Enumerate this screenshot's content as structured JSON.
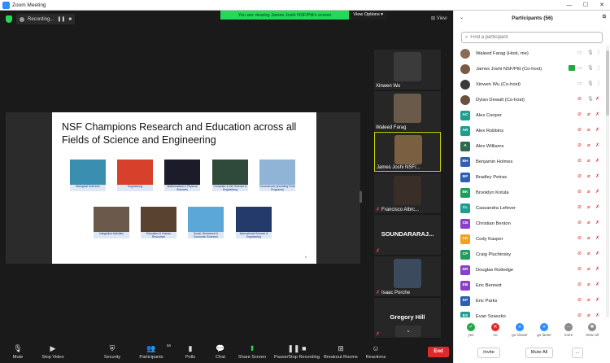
{
  "window": {
    "title": "Zoom Meeting",
    "controls": [
      "—",
      "☐",
      "✕"
    ]
  },
  "banner": {
    "message": "You are viewing James Joshi NSF/Pitt's screen",
    "view_options": "View Options ▾"
  },
  "recording": {
    "label": "Recording...",
    "pause": "❚❚",
    "stop": "■"
  },
  "view_button": "⊞ View",
  "slide": {
    "title": "NSF Champions Research and Education across all Fields of Science and Engineering",
    "page_number": "4",
    "tiles": [
      {
        "caption": "Biological Sciences",
        "color": "#3a8fb0"
      },
      {
        "caption": "Engineering",
        "color": "#d7402a"
      },
      {
        "caption": "Mathematical & Physical Sciences",
        "color": "#1b1b2a"
      },
      {
        "caption": "Computer & Info Science & Engineering",
        "color": "#2f4a3a"
      },
      {
        "caption": "Geosciences (including Polar Programs)",
        "color": "#8fb4d6"
      },
      {
        "caption": "Integrative Activities",
        "color": "#6b5a4c"
      },
      {
        "caption": "Education & Human Resources",
        "color": "#5a4230"
      },
      {
        "caption": "Social, Behavioral & Economic Sciences",
        "color": "#5aa7d8"
      },
      {
        "caption": "International Science & Engineering",
        "color": "#233a6b"
      }
    ]
  },
  "video_strip": [
    {
      "name": "Xinwen Wu",
      "muted": false,
      "active": false,
      "kind": "video"
    },
    {
      "name": "Waleed Farag",
      "muted": false,
      "active": false,
      "kind": "video"
    },
    {
      "name": "James Joshi NSF/...",
      "muted": false,
      "active": true,
      "kind": "video"
    },
    {
      "name": "Francisco Albrc...",
      "muted": true,
      "active": false,
      "kind": "video"
    },
    {
      "name": "SOUNDARARAJ...",
      "muted": true,
      "active": false,
      "kind": "name"
    },
    {
      "name": "Isaac Porche",
      "muted": true,
      "active": false,
      "kind": "video"
    },
    {
      "name": "Gregory Hill",
      "muted": true,
      "active": false,
      "kind": "name"
    }
  ],
  "strip_down": "⌄",
  "toolbar": {
    "mute": "Mute",
    "stop_video": "Stop Video",
    "security": "Security",
    "participants": "Participants",
    "participants_count": "56",
    "polls": "Polls",
    "chat": "Chat",
    "share_screen": "Share Screen",
    "pause_stop_recording": "Pause/Stop Recording",
    "breakout_rooms": "Breakout Rooms",
    "reactions": "Reactions",
    "end": "End"
  },
  "panel": {
    "title": "Participants (56)",
    "search_placeholder": "Find a participant",
    "participants": [
      {
        "name": "Waleed Farag (Host, me)",
        "initials": "",
        "color": "#8a6b55",
        "photo": true,
        "video_on": true,
        "muted": false,
        "share": false
      },
      {
        "name": "James Joshi NSF/Pitt (Co-host)",
        "initials": "",
        "color": "#7a5a45",
        "photo": true,
        "video_on": true,
        "muted": false,
        "share": true
      },
      {
        "name": "Xinwen Wu (Co-host)",
        "initials": "",
        "color": "#3a3a3a",
        "photo": true,
        "video_on": true,
        "muted": false,
        "share": false
      },
      {
        "name": "Dylan Dewalt (Co-host)",
        "initials": "",
        "color": "#6b5040",
        "photo": true,
        "video_on": false,
        "muted": false,
        "share": false
      },
      {
        "name": "Alex Cooper",
        "initials": "AC",
        "color": "#1e9e8f",
        "photo": false,
        "video_on": false,
        "muted": true,
        "share": false
      },
      {
        "name": "Alex Robbins",
        "initials": "AR",
        "color": "#1e9e8f",
        "photo": false,
        "video_on": false,
        "muted": true,
        "share": false
      },
      {
        "name": "Alex Williams",
        "initials": "A",
        "color": "#2a6b4a",
        "photo": false,
        "video_on": false,
        "muted": true,
        "share": false
      },
      {
        "name": "Benjamin Holmes",
        "initials": "BH",
        "color": "#2f5fb3",
        "photo": false,
        "video_on": false,
        "muted": true,
        "share": false
      },
      {
        "name": "Bradley Petras",
        "initials": "BP",
        "color": "#2f5fb3",
        "photo": false,
        "video_on": false,
        "muted": true,
        "share": false
      },
      {
        "name": "Brooklyn Kotula",
        "initials": "BK",
        "color": "#1e9e5a",
        "photo": false,
        "video_on": false,
        "muted": true,
        "share": false
      },
      {
        "name": "Cassandra Lefever",
        "initials": "CL",
        "color": "#1e9e8f",
        "photo": false,
        "video_on": false,
        "muted": true,
        "share": false
      },
      {
        "name": "Christian Benton",
        "initials": "CB",
        "color": "#8a3fc7",
        "photo": false,
        "video_on": false,
        "muted": true,
        "share": false
      },
      {
        "name": "Cody Kasper",
        "initials": "CK",
        "color": "#f2a21b",
        "photo": false,
        "video_on": false,
        "muted": true,
        "share": false
      },
      {
        "name": "Craig Pluchinsky",
        "initials": "CP",
        "color": "#1e9e5a",
        "photo": false,
        "video_on": false,
        "muted": true,
        "share": false
      },
      {
        "name": "Douglas Rutledge",
        "initials": "DR",
        "color": "#8a3fc7",
        "photo": false,
        "video_on": false,
        "muted": true,
        "share": false
      },
      {
        "name": "Eric Bennett",
        "initials": "EB",
        "color": "#8a3fc7",
        "photo": false,
        "video_on": false,
        "muted": true,
        "share": false
      },
      {
        "name": "Eric Parks",
        "initials": "EP",
        "color": "#2f5fb3",
        "photo": false,
        "video_on": false,
        "muted": true,
        "share": false
      },
      {
        "name": "Evan Szaszko",
        "initials": "ES",
        "color": "#1e9e8f",
        "photo": false,
        "video_on": false,
        "muted": true,
        "share": false
      }
    ],
    "reactions": [
      {
        "label": "yes",
        "glyph": "✓",
        "color": "#23a645"
      },
      {
        "label": "no",
        "glyph": "✕",
        "color": "#e02828"
      },
      {
        "label": "go slower",
        "glyph": "«",
        "color": "#2d8cff"
      },
      {
        "label": "go faster",
        "glyph": "»",
        "color": "#2d8cff"
      },
      {
        "label": "more",
        "glyph": "···",
        "color": "#8a8a8a"
      },
      {
        "label": "clear all",
        "glyph": "✖",
        "color": "#8a8a8a"
      }
    ],
    "invite": "Invite",
    "mute_all": "Mute All",
    "more": "..."
  },
  "colors": {
    "accent": "#2d8cff",
    "banner_green": "#23d959",
    "end_red": "#e02828",
    "muted_red": "#e02828",
    "active_border": "#c4d600"
  }
}
